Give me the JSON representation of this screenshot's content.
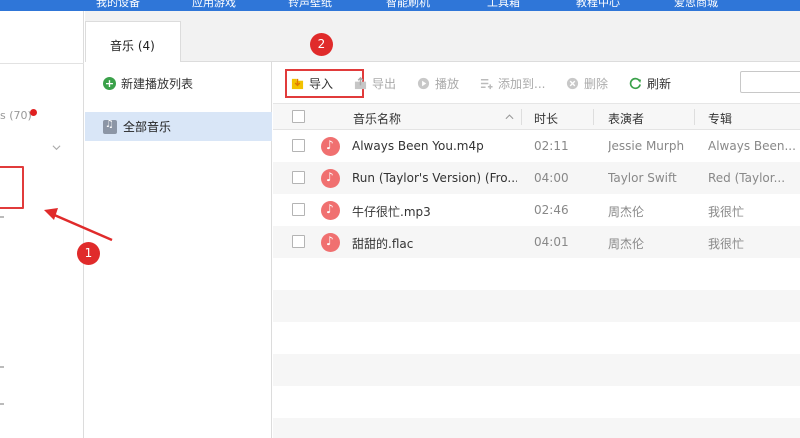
{
  "topnav": {
    "items": [
      "我的设备",
      "应用游戏",
      "铃声壁纸",
      "智能刷机",
      "工具箱",
      "教程中心",
      "爱思商城"
    ]
  },
  "leftcol": {
    "count_text": "s (70)",
    "count_badge_color": "#e02020"
  },
  "tab": {
    "label": "音乐 (4)"
  },
  "playlist": {
    "new_label": "新建播放列表",
    "all_label": "全部音乐"
  },
  "toolbar": {
    "import": "导入",
    "export": "导出",
    "play": "播放",
    "add_to": "添加到...",
    "delete": "删除",
    "refresh": "刷新"
  },
  "table": {
    "headers": {
      "name": "音乐名称",
      "duration": "时长",
      "artist": "表演者",
      "album": "专辑"
    },
    "rows": [
      {
        "name": "Always Been You.m4p",
        "duration": "02:11",
        "artist": "Jessie Murph",
        "album": "Always Been..."
      },
      {
        "name": "Run (Taylor's Version) (Fro...",
        "duration": "04:00",
        "artist": "Taylor Swift",
        "album": "Red (Taylor..."
      },
      {
        "name": "牛仔很忙.mp3",
        "duration": "02:46",
        "artist": "周杰伦",
        "album": "我很忙"
      },
      {
        "name": "甜甜的.flac",
        "duration": "04:01",
        "artist": "周杰伦",
        "album": "我很忙"
      }
    ]
  },
  "annotations": {
    "badge1": "1",
    "badge2": "2",
    "color": "#e02b2b"
  },
  "colors": {
    "nav": "#2f76d8",
    "selected": "#d9e6f7",
    "music_icon": "#f07070"
  }
}
